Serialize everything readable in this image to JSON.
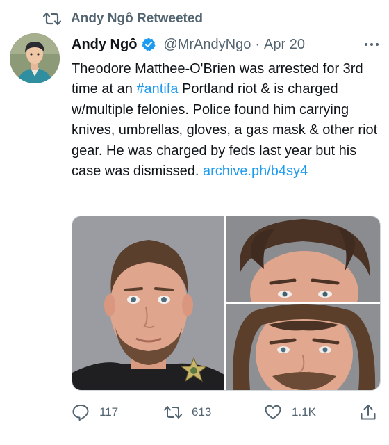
{
  "retweet_banner": {
    "text": "Andy Ngô Retweeted",
    "icon": "retweet-icon"
  },
  "author": {
    "name": "Andy Ngô",
    "handle": "@MrAndyNgo",
    "separator": "·",
    "date": "Apr 20",
    "verified_icon": "verified-badge-icon",
    "more_icon": "more-options-icon"
  },
  "tweet": {
    "text_before_hashtag": "Theodore Matthee-O'Brien was arrested for 3rd time at an ",
    "hashtag": "#antifa",
    "text_after_hashtag": " Portland riot & is charged w/multiple felonies. Police found him carrying knives, umbrellas, gloves, a gas mask & other riot gear. He was charged by feds last year but his case was dismissed. ",
    "link": "archive.ph/b4sy4"
  },
  "media": {
    "photo_count": 3,
    "photos": [
      "mugshot-front",
      "mugshot-closeup-1",
      "mugshot-closeup-2"
    ]
  },
  "actions": {
    "reply_count": "117",
    "retweet_count": "613",
    "like_count": "1.1K",
    "reply_icon": "reply-icon",
    "retweet_icon": "retweet-icon",
    "like_icon": "heart-icon",
    "share_icon": "share-icon"
  },
  "colors": {
    "link": "#1d9bf0",
    "secondary_text": "#536471",
    "primary_text": "#0f1419",
    "verified": "#1d9bf0"
  }
}
